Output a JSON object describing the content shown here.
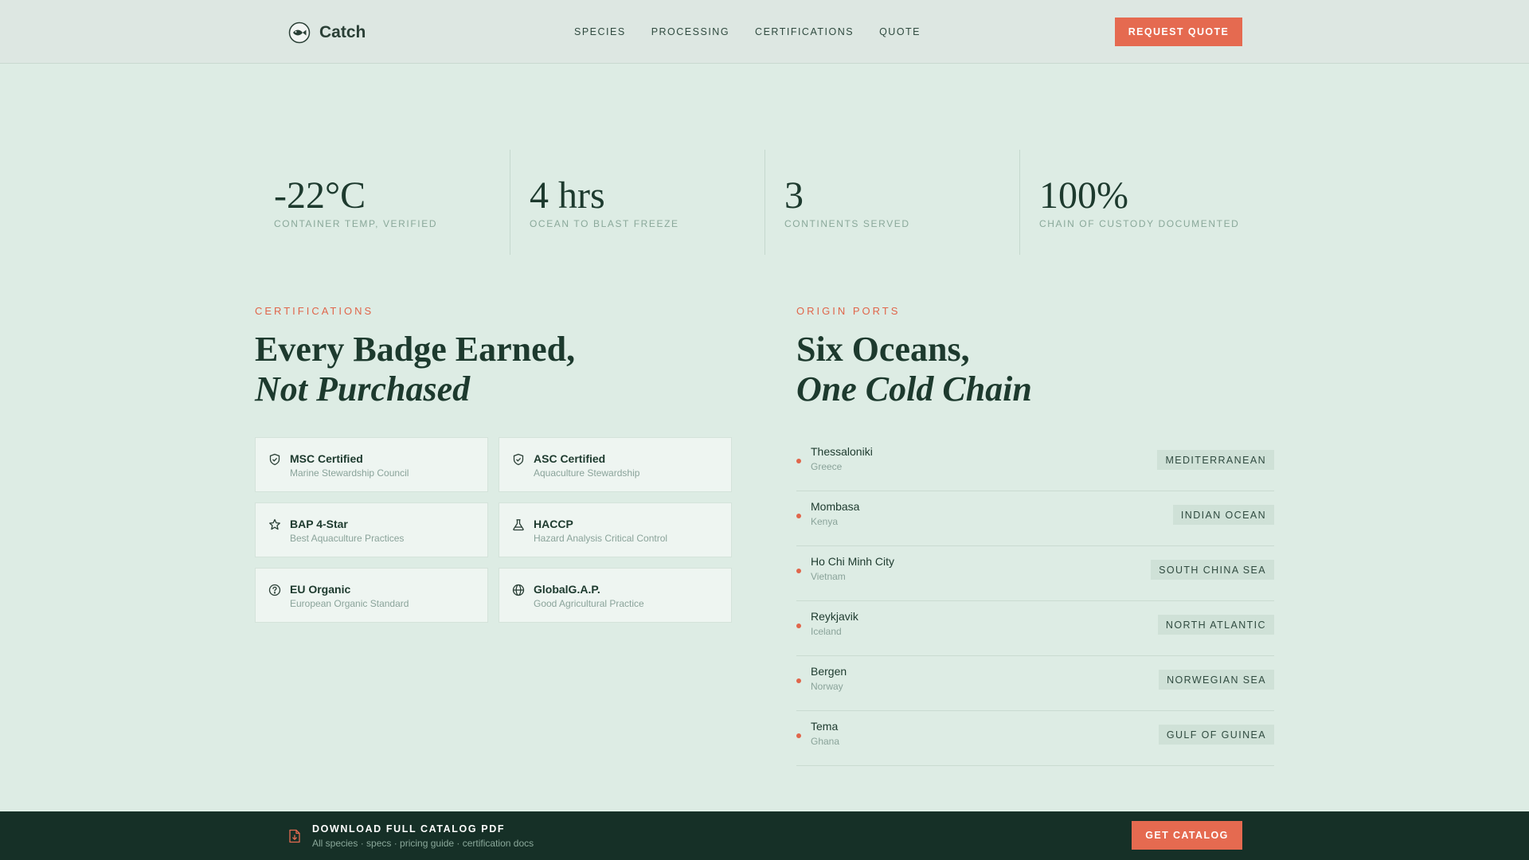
{
  "header": {
    "brand": "Catch",
    "nav": [
      "SPECIES",
      "PROCESSING",
      "CERTIFICATIONS",
      "QUOTE"
    ],
    "cta": "REQUEST QUOTE"
  },
  "stats": [
    {
      "value": "-22°C",
      "label": "CONTAINER TEMP, VERIFIED"
    },
    {
      "value": "4 hrs",
      "label": "OCEAN TO BLAST FREEZE"
    },
    {
      "value": "3",
      "label": "CONTINENTS SERVED"
    },
    {
      "value": "100%",
      "label": "CHAIN OF CUSTODY DOCUMENTED"
    }
  ],
  "certifications": {
    "eyebrow": "CERTIFICATIONS",
    "heading_line1": "Every Badge Earned,",
    "heading_line2": "Not Purchased",
    "items": [
      {
        "icon": "shield-check-icon",
        "title": "MSC Certified",
        "sub": "Marine Stewardship Council"
      },
      {
        "icon": "shield-check-icon",
        "title": "ASC Certified",
        "sub": "Aquaculture Stewardship"
      },
      {
        "icon": "star-icon",
        "title": "BAP 4-Star",
        "sub": "Best Aquaculture Practices"
      },
      {
        "icon": "flask-icon",
        "title": "HACCP",
        "sub": "Hazard Analysis Critical Control"
      },
      {
        "icon": "help-circle-icon",
        "title": "EU Organic",
        "sub": "European Organic Standard"
      },
      {
        "icon": "globe-icon",
        "title": "GlobalG.A.P.",
        "sub": "Good Agricultural Practice"
      }
    ]
  },
  "ports": {
    "eyebrow": "ORIGIN PORTS",
    "heading_line1": "Six Oceans,",
    "heading_line2": "One Cold Chain",
    "items": [
      {
        "name": "Thessaloniki",
        "country": "Greece",
        "sea": "MEDITERRANEAN"
      },
      {
        "name": "Mombasa",
        "country": "Kenya",
        "sea": "INDIAN OCEAN"
      },
      {
        "name": "Ho Chi Minh City",
        "country": "Vietnam",
        "sea": "SOUTH CHINA SEA"
      },
      {
        "name": "Reykjavik",
        "country": "Iceland",
        "sea": "NORTH ATLANTIC"
      },
      {
        "name": "Bergen",
        "country": "Norway",
        "sea": "NORWEGIAN SEA"
      },
      {
        "name": "Tema",
        "country": "Ghana",
        "sea": "GULF OF GUINEA"
      }
    ]
  },
  "footer": {
    "title": "DOWNLOAD FULL CATALOG PDF",
    "sub": "All species · specs · pricing guide · certification docs",
    "cta": "GET CATALOG"
  },
  "colors": {
    "background": "#ddece4",
    "accent": "#e56a50",
    "dark": "#163027",
    "text": "#1d3a2e"
  }
}
